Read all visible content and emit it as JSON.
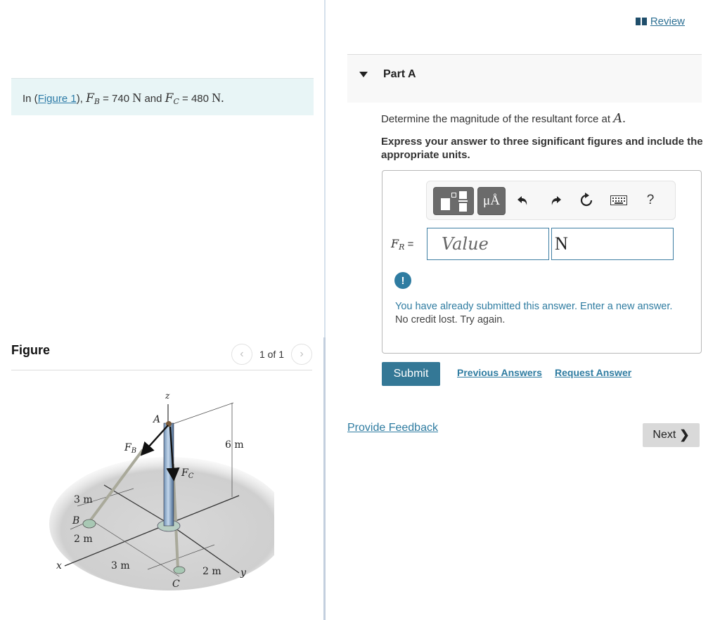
{
  "problem": {
    "prefix": "In (",
    "figure_link": "Figure 1",
    "suffix": "),",
    "fb_symbol": "F",
    "fb_sub": "B",
    "fb_eq": "= 740",
    "fb_unit": "N",
    "and": "and",
    "fc_symbol": "F",
    "fc_sub": "C",
    "fc_eq": "= 480",
    "fc_unit": "N",
    "end": "."
  },
  "figure_panel": {
    "title": "Figure",
    "pager_text": "1 of 1",
    "prev_icon": "chevron-left-icon",
    "next_icon": "chevron-right-icon",
    "labels": {
      "z": "z",
      "A": "A",
      "FB": "F",
      "FB_sub": "B",
      "FC": "F",
      "FC_sub": "C",
      "height": "6 m",
      "left_3m": "3 m",
      "B": "B",
      "left_2m": "2 m",
      "x": "x",
      "bottom_3m": "3 m",
      "C": "C",
      "bottom_2m": "2 m",
      "y": "y"
    }
  },
  "review": {
    "icon": "book-icon",
    "label": "Review"
  },
  "part": {
    "title": "Part A",
    "question_text": "Determine the magnitude of the resultant force at",
    "question_var": "A",
    "question_end": ".",
    "instructions": "Express your answer to three significant figures and include the appropriate units."
  },
  "toolbar": {
    "templates_icon": "templates-icon",
    "units_label": "μÅ",
    "undo_icon": "undo-icon",
    "redo_icon": "redo-icon",
    "reset_icon": "reset-icon",
    "keyboard_icon": "keyboard-icon",
    "help_label": "?"
  },
  "answer": {
    "var_symbol": "F",
    "var_sub": "R",
    "equals": "=",
    "value_placeholder": "Value",
    "value": "",
    "unit_value": "N"
  },
  "feedback": {
    "icon": "exclamation-icon",
    "message": "You have already submitted this answer. Enter a new answer.",
    "note": "No credit lost. Try again."
  },
  "actions": {
    "submit": "Submit",
    "previous_answers": "Previous Answers",
    "request_answer": "Request Answer",
    "provide_feedback": "Provide Feedback",
    "next": "Next"
  },
  "colors": {
    "link": "#2f7ca1",
    "submit_bg": "#347896",
    "problem_bg": "#e8f5f6",
    "next_bg": "#d9d9d9"
  }
}
